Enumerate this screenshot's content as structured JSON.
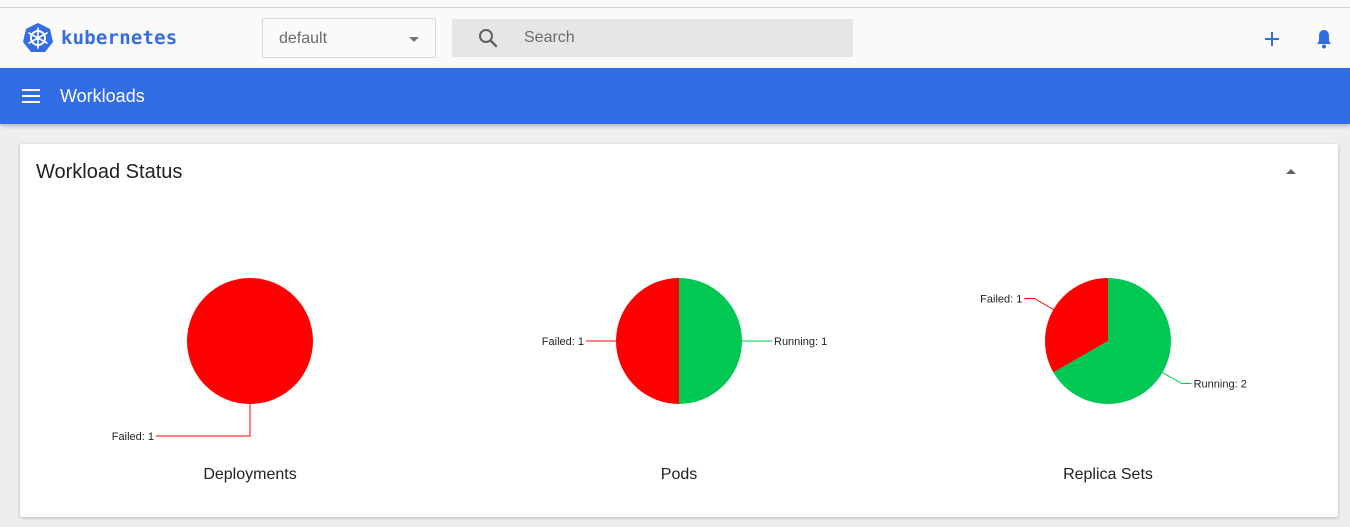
{
  "header": {
    "brand": "kubernetes",
    "namespace": {
      "selected": "default"
    },
    "search": {
      "placeholder": "Search"
    },
    "icons": {
      "logo": "kubernetes-logo-icon",
      "search": "search-icon",
      "add": "add-icon",
      "notifications": "bell-icon",
      "menu": "menu-icon"
    }
  },
  "appbar": {
    "title": "Workloads"
  },
  "workload_status": {
    "title": "Workload Status",
    "collapse_icon": "arrow-up-icon"
  },
  "colors": {
    "brand": "#326de6",
    "failed": "#ff0000",
    "running": "#00c853"
  },
  "chart_data": [
    {
      "type": "pie",
      "title": "Deployments",
      "slices": [
        {
          "label": "Failed: 1",
          "name": "Failed",
          "value": 1
        }
      ]
    },
    {
      "type": "pie",
      "title": "Pods",
      "slices": [
        {
          "label": "Failed: 1",
          "name": "Failed",
          "value": 1
        },
        {
          "label": "Running: 1",
          "name": "Running",
          "value": 1
        }
      ]
    },
    {
      "type": "pie",
      "title": "Replica Sets",
      "slices": [
        {
          "label": "Failed: 1",
          "name": "Failed",
          "value": 1
        },
        {
          "label": "Running: 2",
          "name": "Running",
          "value": 2
        }
      ]
    }
  ]
}
